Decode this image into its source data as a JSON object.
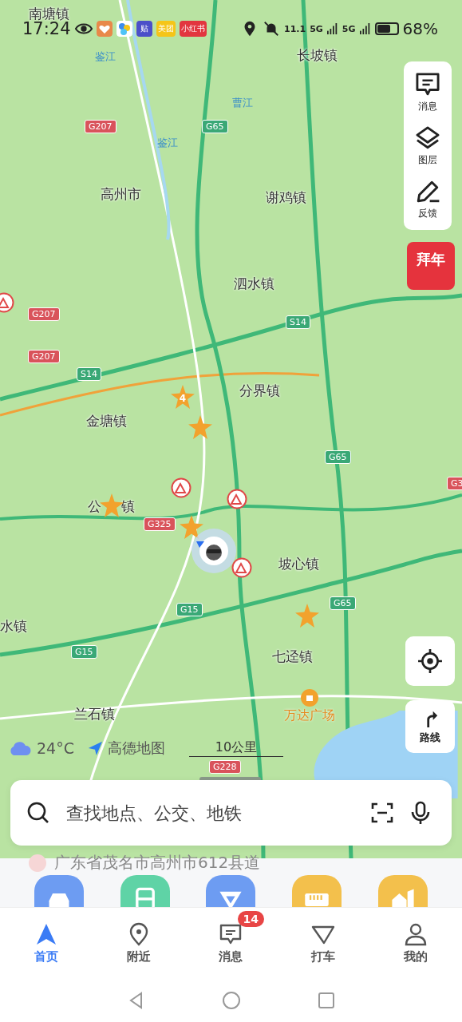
{
  "status_bar": {
    "time": "17:24",
    "apps": [
      {
        "kind": "heart",
        "color": "#e8894a"
      },
      {
        "kind": "pinwheel",
        "color": "#ffffff"
      },
      {
        "kind": "text",
        "label": "贴",
        "color": "#4b4fc9"
      },
      {
        "kind": "text",
        "label": "美团",
        "color": "#f5c518"
      },
      {
        "kind": "text",
        "label": "小红书",
        "color": "#e2363f"
      }
    ],
    "speed": "11.1",
    "network_1": "5G",
    "network_2": "5G",
    "battery": "68%"
  },
  "map": {
    "place_labels": [
      "南塘镇",
      "长坡镇",
      "高州市",
      "谢鸡镇",
      "泗水镇",
      "分界镇",
      "金塘镇",
      "公",
      "镇",
      "坡心镇",
      "水镇",
      "七迳镇",
      "兰石镇"
    ],
    "river_labels": [
      "鉴江",
      "曹江",
      "鉴江"
    ],
    "road_shields": [
      {
        "label": "G207",
        "kind": "national"
      },
      {
        "label": "G65",
        "kind": "expressway"
      },
      {
        "label": "G207",
        "kind": "national"
      },
      {
        "label": "S14",
        "kind": "expressway"
      },
      {
        "label": "G207",
        "kind": "national"
      },
      {
        "label": "S14",
        "kind": "expressway"
      },
      {
        "label": "G65",
        "kind": "expressway"
      },
      {
        "label": "G3",
        "kind": "national"
      },
      {
        "label": "G325",
        "kind": "national"
      },
      {
        "label": "G65",
        "kind": "expressway"
      },
      {
        "label": "G15",
        "kind": "expressway"
      },
      {
        "label": "G15",
        "kind": "expressway"
      },
      {
        "label": "G228",
        "kind": "national"
      }
    ],
    "markers": [
      {
        "kind": "star",
        "count": "4"
      },
      {
        "kind": "star"
      },
      {
        "kind": "star"
      },
      {
        "kind": "star"
      },
      {
        "kind": "star"
      },
      {
        "kind": "construction"
      },
      {
        "kind": "construction"
      },
      {
        "kind": "construction"
      },
      {
        "kind": "construction"
      }
    ],
    "poi": {
      "label": "万达广场"
    },
    "weather": {
      "temperature": "24°C"
    },
    "brand": "高德地图",
    "scale": "10公里"
  },
  "side_tools": [
    {
      "kind": "message",
      "label": "消息"
    },
    {
      "kind": "layers",
      "label": "图层"
    },
    {
      "kind": "feedback",
      "label": "反馈"
    }
  ],
  "promo": {
    "label": "拜年"
  },
  "route_button": {
    "label": "路线"
  },
  "search": {
    "placeholder": "查找地点、公交、地铁"
  },
  "current_address": "广东省茂名市高州市612县道",
  "quick_actions": [
    {
      "kind": "car",
      "color": "#6d9cf2"
    },
    {
      "kind": "bus",
      "color": "#5fd3a6"
    },
    {
      "kind": "taxi",
      "color": "#6d9cf2"
    },
    {
      "kind": "ruler",
      "color": "#f3c04c"
    },
    {
      "kind": "house",
      "color": "#f3c04c"
    }
  ],
  "tabs": [
    {
      "kind": "home",
      "label": "首页",
      "selected": true
    },
    {
      "kind": "nearby",
      "label": "附近",
      "selected": false
    },
    {
      "kind": "message",
      "label": "消息",
      "selected": false,
      "badge": "14"
    },
    {
      "kind": "taxi",
      "label": "打车",
      "selected": false
    },
    {
      "kind": "profile",
      "label": "我的",
      "selected": false
    }
  ]
}
